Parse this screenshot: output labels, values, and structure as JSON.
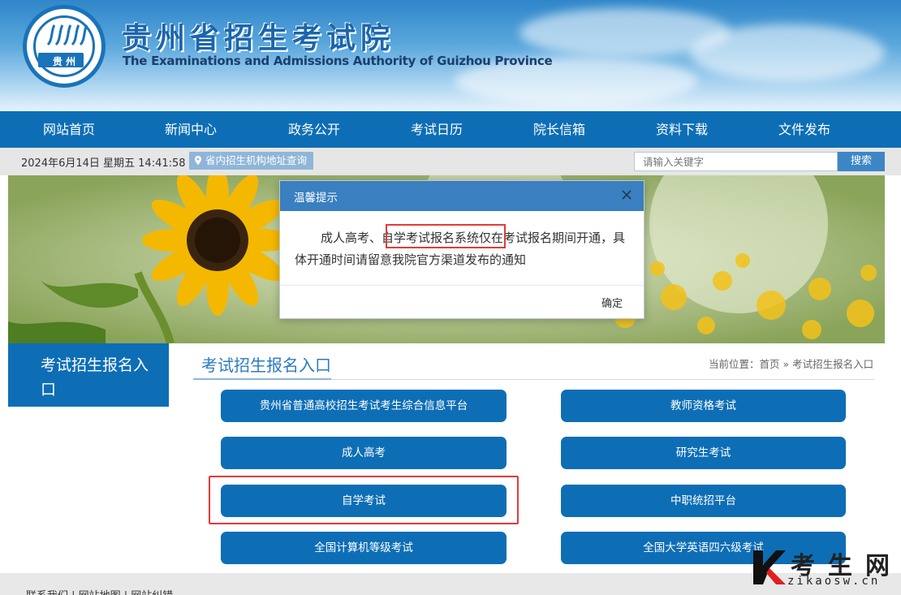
{
  "header": {
    "logo_text": "贵 州",
    "title_cn": "贵州省招生考试院",
    "title_en": "The Examinations and Admissions Authority of Guizhou Province"
  },
  "nav": {
    "items": [
      {
        "label": "网站首页"
      },
      {
        "label": "新闻中心"
      },
      {
        "label": "政务公开"
      },
      {
        "label": "考试日历"
      },
      {
        "label": "院长信箱"
      },
      {
        "label": "资料下载"
      },
      {
        "label": "文件发布"
      }
    ]
  },
  "infobar": {
    "datetime": "2024年6月14日 星期五 14:41:58",
    "address_link": "省内招生机构地址查询",
    "search_placeholder": "请输入关键字",
    "search_button": "搜索"
  },
  "sidebar": {
    "tab_label": "考试招生报名入口"
  },
  "content": {
    "title": "考试招生报名入口",
    "breadcrumb": "当前位置：首页 » 考试招生报名入口",
    "entries": [
      {
        "label": "贵州省普通高校招生考试考生综合信息平台"
      },
      {
        "label": "教师资格考试"
      },
      {
        "label": "成人高考"
      },
      {
        "label": "研究生考试"
      },
      {
        "label": "自学考试"
      },
      {
        "label": "中职统招平台"
      },
      {
        "label": "全国计算机等级考试"
      },
      {
        "label": "全国大学英语四六级考试"
      }
    ]
  },
  "footer": {
    "text": "联系我们  |  网站地图  |  网站纠错"
  },
  "modal": {
    "title": "温馨提示",
    "body_before": "成人高考、",
    "body_highlight": "自学考试报名系统",
    "body_after": "仅在考试报名期间开通，具体开通时间请留意我院官方渠道发布的通知",
    "ok_button": "确定"
  },
  "watermark": {
    "cn": "考生网",
    "en": "zikaosw.cn"
  },
  "colors": {
    "primary": "#0d6eb6",
    "modal_header": "#3a7fbf",
    "highlight_red": "#e23b3b"
  }
}
